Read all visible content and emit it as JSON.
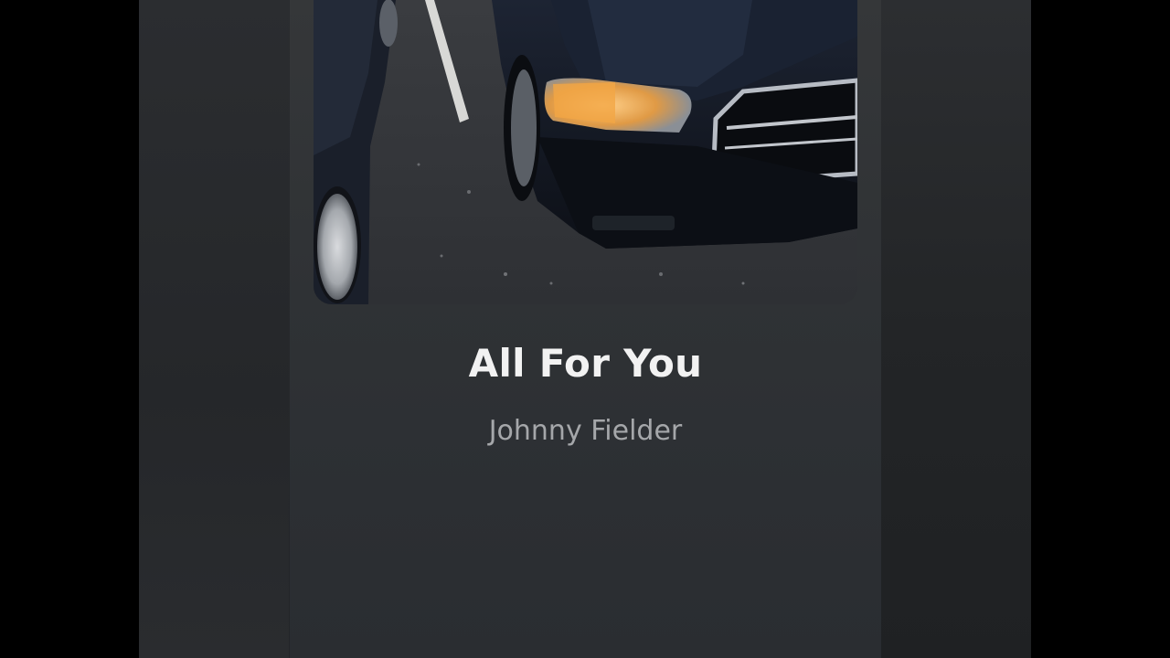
{
  "now_playing": {
    "title": "All For You",
    "artist": "Johnny Fielder",
    "artwork_icon": "album-artwork-car-photo"
  },
  "theme": {
    "background": "#2f3235",
    "title_color": "#f2f2f2",
    "artist_color": "#a5a7aa"
  }
}
